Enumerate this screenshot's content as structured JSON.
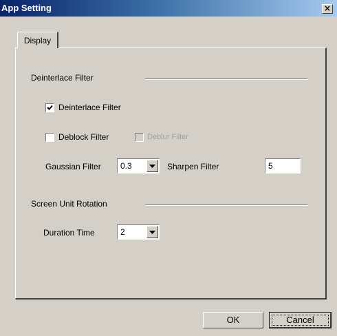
{
  "window": {
    "title": "App Setting",
    "close_label": "×"
  },
  "tabs": [
    {
      "label": "Display",
      "selected": true
    }
  ],
  "deinterlace_group": {
    "header": "Deinterlace Filter",
    "deinterlace_filter": {
      "label": "Deinterlace Filter",
      "checked": true
    },
    "deblock_filter": {
      "label": "Deblock Filter",
      "checked": false
    },
    "deblur_filter": {
      "label": "Deblur Filter",
      "checked": false,
      "disabled": true
    },
    "gaussian_filter": {
      "label": "Gaussian Filter",
      "value": "0.3"
    },
    "sharpen_filter": {
      "label": "Sharpen Filter",
      "value": "5"
    }
  },
  "rotation_group": {
    "header": "Screen Unit Rotation",
    "duration_time": {
      "label": "Duration Time",
      "value": "2"
    }
  },
  "buttons": {
    "ok": "OK",
    "cancel": "Cancel"
  },
  "colors": {
    "title_start": "#0a246a",
    "title_end": "#a6caf0",
    "face": "#d4d0c8"
  },
  "icons": {
    "close": "close-icon",
    "dropdown": "chevron-down-icon",
    "check": "checkmark-icon"
  }
}
